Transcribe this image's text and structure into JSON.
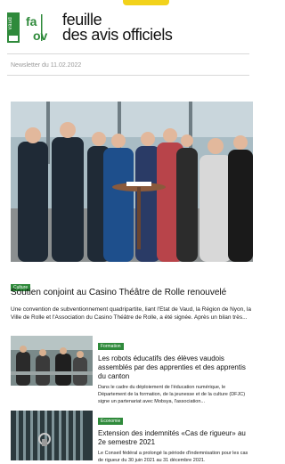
{
  "brand": {
    "canton": "vaud",
    "monogram": "faov",
    "name_line1": "feuille",
    "name_line2": "des avis officiels",
    "accent_green": "#2f8a3b",
    "accent_yellow": "#f2d21b"
  },
  "issue_label": "Newsletter du 11.02.2022",
  "main_article": {
    "category": "Culture",
    "title": "Soutien conjoint au Casino Théâtre de Rolle renouvelé",
    "lead": "Une convention de subventionnement quadripartite, liant l'Etat de Vaud, la Région de Nyon, la Ville de Rolle et l'Association du Casino Théâtre de Rolle, a été signée. Après un bilan très..."
  },
  "articles": [
    {
      "category": "Formation",
      "title": "Les robots éducatifs des élèves vaudois assemblés par des apprenties et des apprentis du canton",
      "text": "Dans le cadre du déploiement de l'éducation numérique, le Département de la formation, de la jeunesse et de la culture (DFJC) signe un partenariat avec Mobsya, l'association..."
    },
    {
      "category": "Economie",
      "title": "Extension des indemnités «Cas de rigueur» au 2e semestre 2021",
      "text": "Le Conseil fédéral a prolongé la période d'indemnisation pour les cas de rigueur du 30 juin 2021 au 31 décembre 2021."
    }
  ]
}
